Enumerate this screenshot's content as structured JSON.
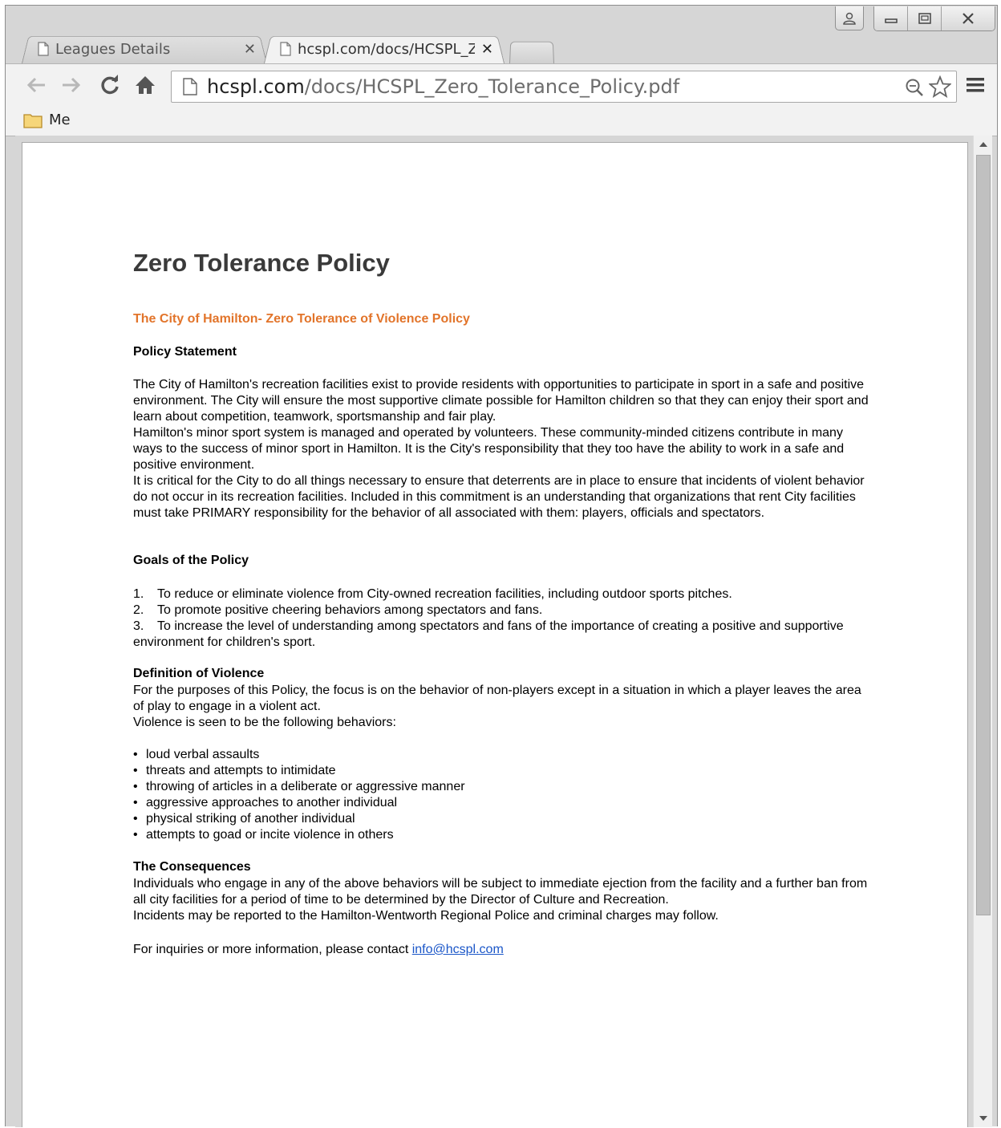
{
  "tabs": [
    {
      "label": "Leagues Details",
      "active": false
    },
    {
      "label": "hcspl.com/docs/HCSPL_Ze",
      "active": true
    }
  ],
  "address_bar": {
    "host": "hcspl.com",
    "path": "/docs/HCSPL_Zero_Tolerance_Policy.pdf"
  },
  "bookmarks": [
    {
      "label": "Me",
      "icon": "folder-icon"
    }
  ],
  "document": {
    "title": "Zero Tolerance Policy",
    "subtitle": "The City of Hamilton- Zero Tolerance of Violence Policy",
    "policy_statement": {
      "heading": "Policy Statement",
      "paragraphs": [
        "The City of Hamilton's recreation facilities exist to provide residents with opportunities to participate in sport in a safe and positive environment. The City will ensure the most supportive climate possible for Hamilton children so that they can enjoy their sport and learn about competition, teamwork, sportsmanship and fair play.",
        "Hamilton's minor sport system is managed and operated by volunteers. These community-minded citizens contribute in many ways to the success of minor sport in Hamilton. It is the City's responsibility that they too have the ability to work in a safe and positive environment.",
        "It is critical for the City to do all things necessary to ensure that deterrents are in place to ensure that incidents of violent behavior do not occur in its recreation facilities. Included in this commitment is an understanding that organizations that rent City facilities must take PRIMARY responsibility for the behavior of all associated with them: players, officials and spectators."
      ]
    },
    "goals": {
      "heading": "Goals of the Policy",
      "items": [
        {
          "num": "1.",
          "text": "To reduce or eliminate violence from City-owned recreation facilities, including outdoor sports pitches."
        },
        {
          "num": "2.",
          "text": "To promote positive cheering behaviors among spectators and fans."
        },
        {
          "num": "3.",
          "text": "To increase the level of understanding among spectators and fans of the importance of creating a positive and supportive environment for children's sport."
        }
      ]
    },
    "definition": {
      "heading": "Definition of Violence",
      "paragraphs": [
        "For the purposes of this Policy, the focus is on the behavior of non-players except in a situation in which a player leaves the area of play to engage in a violent act.",
        "Violence is seen to be the following behaviors:"
      ],
      "bullets": [
        "loud verbal assaults",
        "threats and attempts to intimidate",
        "throwing of articles in a deliberate or aggressive manner",
        "aggressive approaches to another individual",
        "physical striking of another individual",
        "attempts to goad or incite violence in others"
      ]
    },
    "consequences": {
      "heading": "The Consequences",
      "paragraphs": [
        "Individuals who engage in any of the above behaviors will be subject to immediate ejection from the facility and a further ban from all city facilities for a period of time to be determined by the Director of Culture and Recreation.",
        "Incidents may be reported to the Hamilton-Wentworth Regional Police and criminal charges may follow."
      ]
    },
    "contact": {
      "text": "For inquiries or more information, please contact ",
      "email": "info@hcspl.com"
    }
  }
}
